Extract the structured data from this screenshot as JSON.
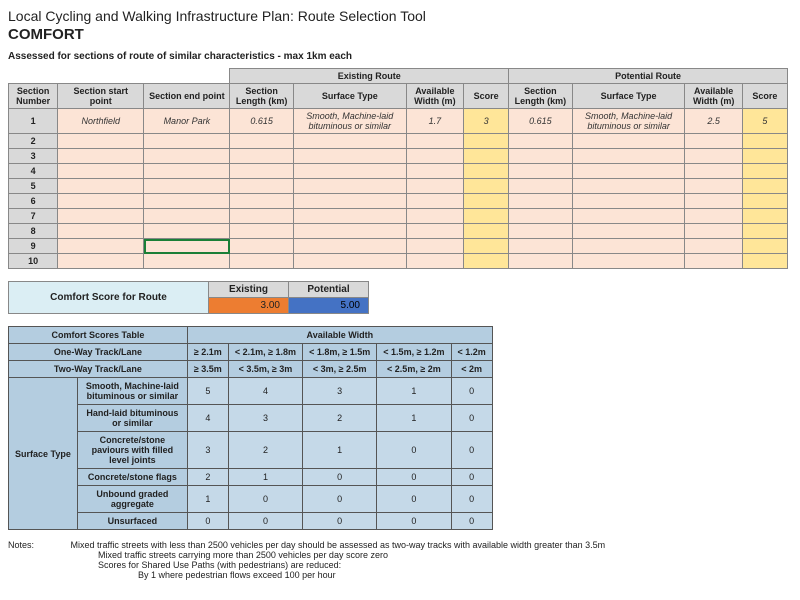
{
  "header": {
    "title": "Local Cycling and Walking Infrastructure Plan: Route Selection Tool",
    "subtitle": "COMFORT",
    "assessed": "Assessed for sections of route of similar characteristics - max 1km each"
  },
  "main": {
    "group_existing": "Existing Route",
    "group_potential": "Potential Route",
    "cols": {
      "section_number": "Section Number",
      "start": "Section start point",
      "end": "Section end point",
      "length": "Section Length (km)",
      "surface": "Surface Type",
      "width": "Available Width (m)",
      "score": "Score"
    },
    "rows": [
      {
        "n": "1",
        "start": "Northfield",
        "end": "Manor Park",
        "elen": "0.615",
        "esurf": "Smooth, Machine-laid bituminous or similar",
        "ewid": "1.7",
        "escore": "3",
        "plen": "0.615",
        "psurf": "Smooth, Machine-laid bituminous or similar",
        "pwid": "2.5",
        "pscore": "5"
      },
      {
        "n": "2"
      },
      {
        "n": "3"
      },
      {
        "n": "4"
      },
      {
        "n": "5"
      },
      {
        "n": "6"
      },
      {
        "n": "7"
      },
      {
        "n": "8"
      },
      {
        "n": "9"
      },
      {
        "n": "10"
      }
    ]
  },
  "route_score": {
    "label": "Comfort Score for Route",
    "existing_label": "Existing",
    "potential_label": "Potential",
    "existing_value": "3.00",
    "potential_value": "5.00"
  },
  "comfort": {
    "title": "Comfort Scores Table",
    "width_label": "Available Width",
    "oneway": "One-Way Track/Lane",
    "twoway": "Two-Way Track/Lane",
    "surface_label": "Surface Type",
    "oneway_widths": [
      "≥ 2.1m",
      "< 2.1m, ≥ 1.8m",
      "< 1.8m, ≥ 1.5m",
      "< 1.5m, ≥ 1.2m",
      "< 1.2m"
    ],
    "twoway_widths": [
      "≥ 3.5m",
      "< 3.5m, ≥ 3m",
      "< 3m, ≥ 2.5m",
      "< 2.5m, ≥ 2m",
      "< 2m"
    ],
    "surfaces": [
      {
        "name": "Smooth, Machine-laid bituminous or similar",
        "vals": [
          "5",
          "4",
          "3",
          "1",
          "0"
        ]
      },
      {
        "name": "Hand-laid bituminous or similar",
        "vals": [
          "4",
          "3",
          "2",
          "1",
          "0"
        ]
      },
      {
        "name": "Concrete/stone paviours with filled level joints",
        "vals": [
          "3",
          "2",
          "1",
          "0",
          "0"
        ]
      },
      {
        "name": "Concrete/stone flags",
        "vals": [
          "2",
          "1",
          "0",
          "0",
          "0"
        ]
      },
      {
        "name": "Unbound graded aggregate",
        "vals": [
          "1",
          "0",
          "0",
          "0",
          "0"
        ]
      },
      {
        "name": "Unsurfaced",
        "vals": [
          "0",
          "0",
          "0",
          "0",
          "0"
        ]
      }
    ]
  },
  "notes": {
    "label": "Notes:",
    "lines": [
      "Mixed traffic streets with less than 2500 vehicles per day should be assessed as two-way tracks with available width greater than 3.5m",
      "Mixed traffic streets carrying more than 2500 vehicles per day score zero",
      "Scores for Shared Use Paths (with pedestrians) are reduced:",
      "By 1 where pedestrian flows exceed 100 per hour"
    ]
  }
}
